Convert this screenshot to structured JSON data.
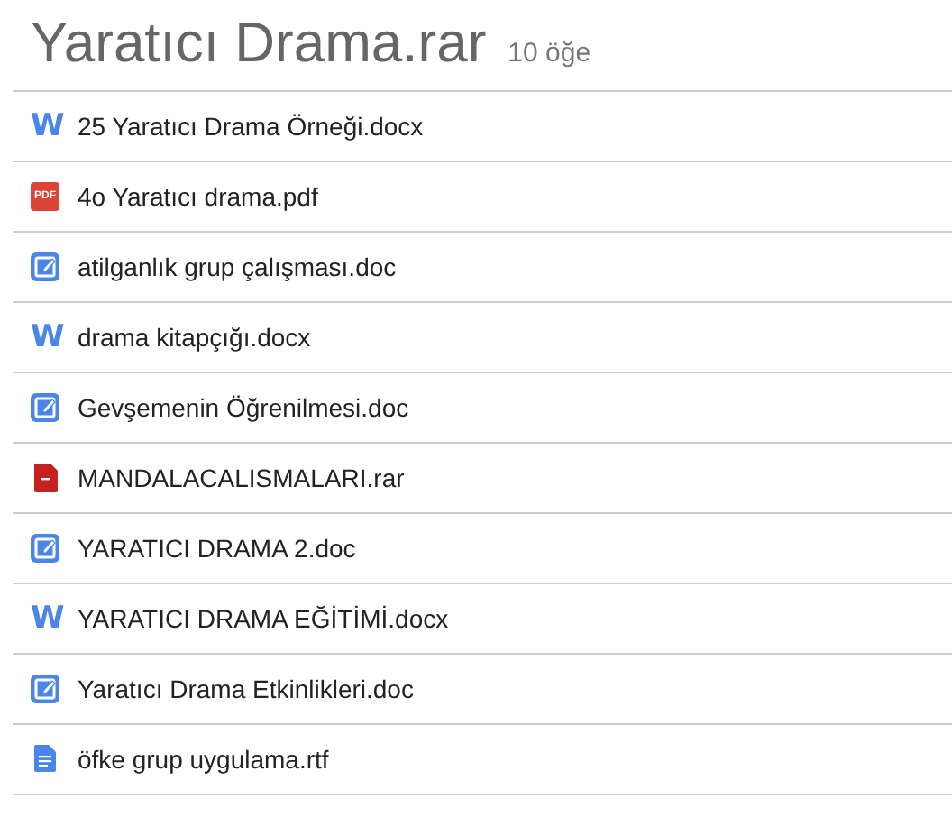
{
  "header": {
    "title": "Yaratıcı Drama.rar",
    "count": "10 öğe"
  },
  "files": [
    {
      "name": "25 Yaratıcı Drama Örneği.docx",
      "kind": "word",
      "icon_label": "W"
    },
    {
      "name": "4o Yaratıcı drama.pdf",
      "kind": "pdf",
      "icon_label": "PDF"
    },
    {
      "name": "atilganlık grup çalışması.doc",
      "kind": "edit"
    },
    {
      "name": "drama kitapçığı.docx",
      "kind": "word",
      "icon_label": "W"
    },
    {
      "name": "Gevşemenin Öğrenilmesi.doc",
      "kind": "edit"
    },
    {
      "name": "MANDALACALISMALARI.rar",
      "kind": "archive"
    },
    {
      "name": "YARATICI DRAMA 2.doc",
      "kind": "edit"
    },
    {
      "name": "YARATICI DRAMA EĞİTİMİ.docx",
      "kind": "word",
      "icon_label": "W"
    },
    {
      "name": "Yaratıcı Drama Etkinlikleri.doc",
      "kind": "edit"
    },
    {
      "name": "öfke grup uygulama.rtf",
      "kind": "doc"
    }
  ]
}
